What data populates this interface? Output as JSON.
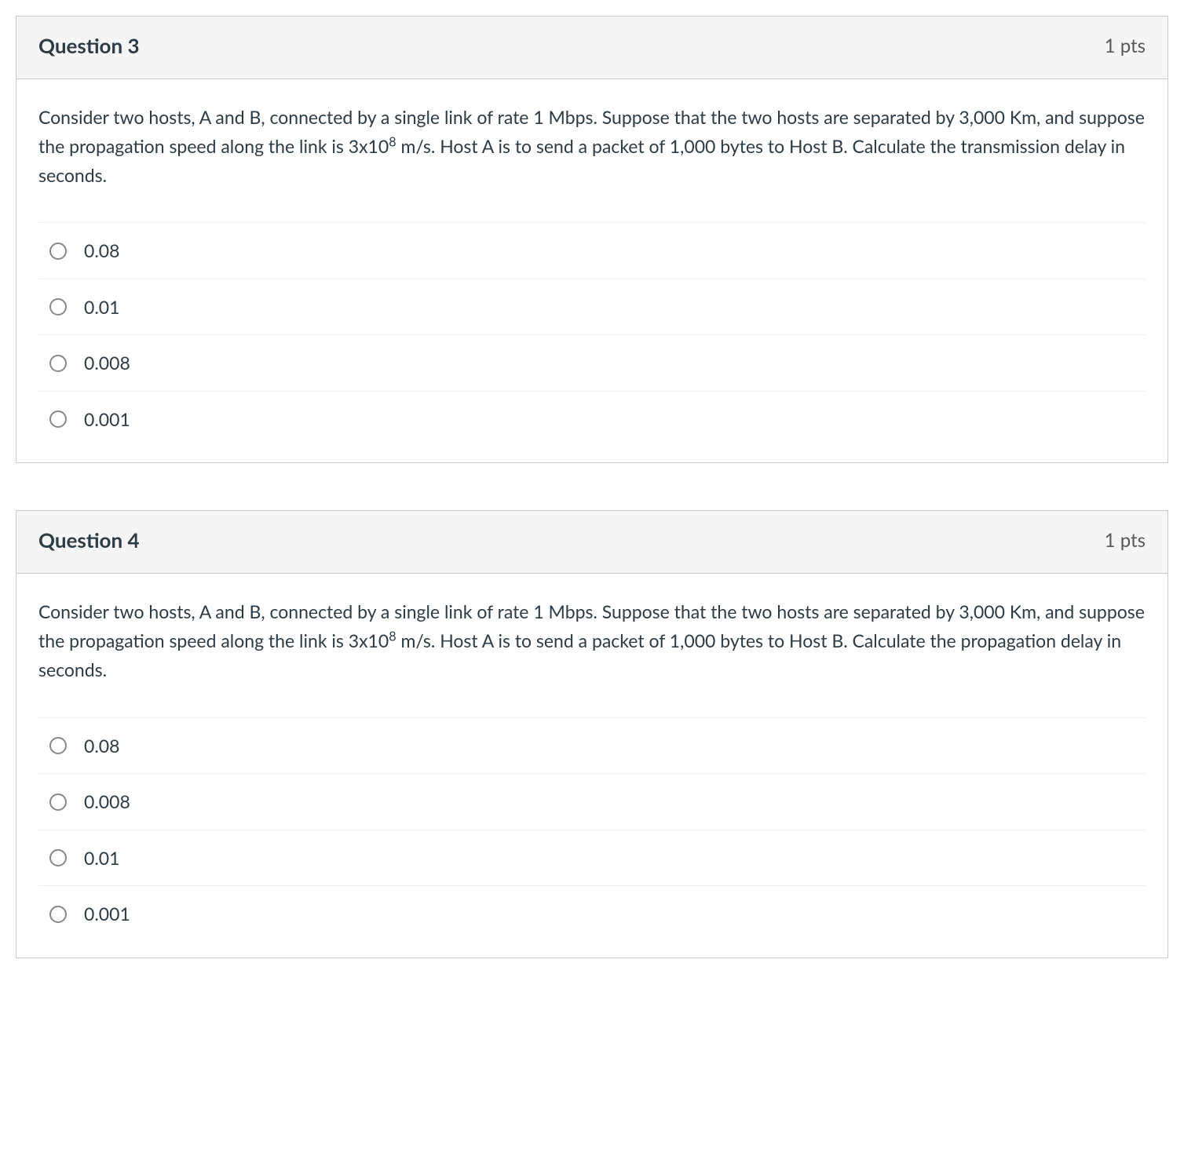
{
  "questions": [
    {
      "title": "Question 3",
      "points": "1 pts",
      "text_before_sup": "Consider two hosts, A and B, connected by a single link of rate 1 Mbps. Suppose that the two hosts are separated by 3,000 Km, and suppose the propagation speed along the link is 3x10",
      "sup": "8",
      "text_after_sup": " m/s. Host A is to send a packet of 1,000 bytes to Host B. Calculate the transmission delay in seconds.",
      "options": [
        "0.08",
        "0.01",
        "0.008",
        "0.001"
      ]
    },
    {
      "title": "Question 4",
      "points": "1 pts",
      "text_before_sup": "Consider two hosts, A and B, connected by a single link of rate 1 Mbps. Suppose that the two hosts are separated by 3,000 Km, and suppose the propagation speed along the link is 3x10",
      "sup": "8",
      "text_after_sup": " m/s. Host A is to send a packet of 1,000 bytes to Host B. Calculate the propagation delay in seconds.",
      "options": [
        "0.08",
        "0.008",
        "0.01",
        "0.001"
      ]
    }
  ]
}
